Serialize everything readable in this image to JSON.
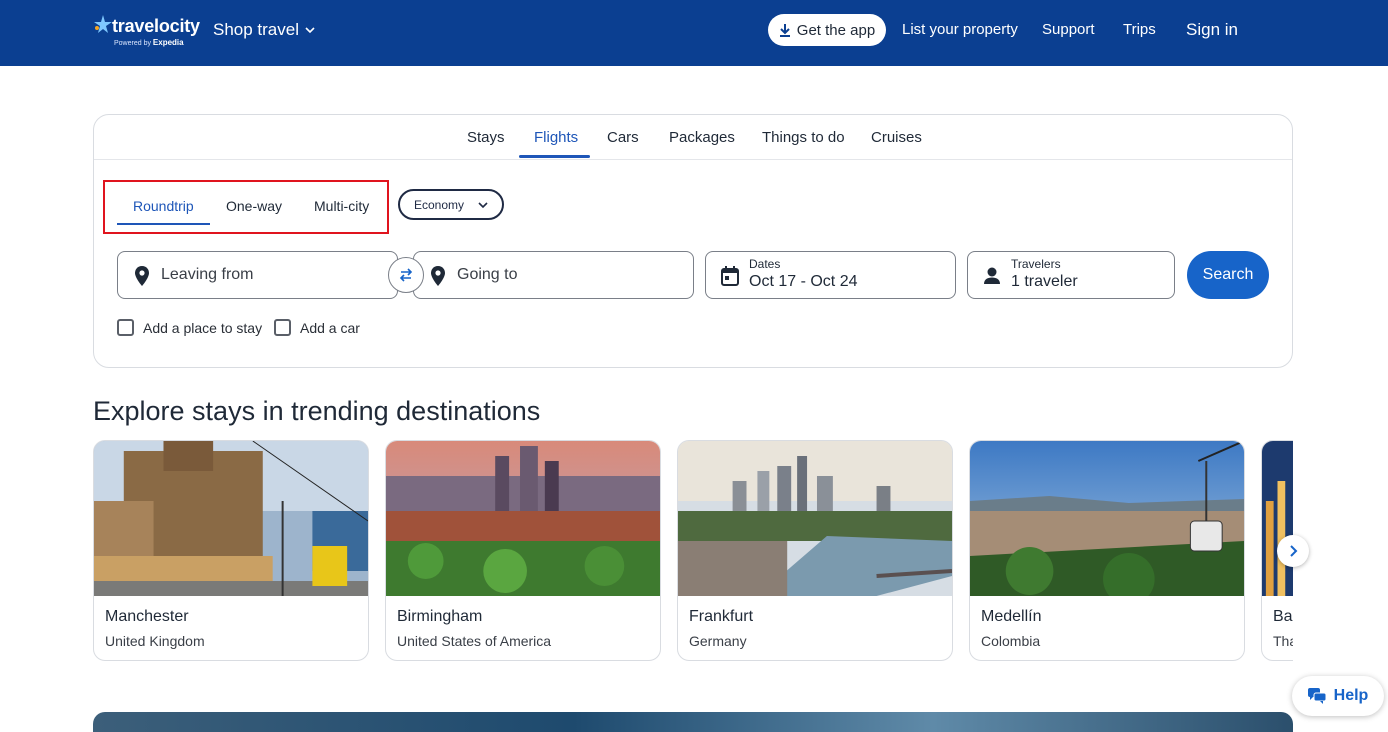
{
  "header": {
    "logo_text": "travelocity",
    "logo_powered": "Powered by",
    "logo_brand": "Expedia",
    "shop_label": "Shop travel",
    "get_app_label": "Get the app",
    "list_property_label": "List your property",
    "support_label": "Support",
    "trips_label": "Trips",
    "sign_in_label": "Sign in"
  },
  "search": {
    "tabs": [
      {
        "label": "Stays"
      },
      {
        "label": "Flights",
        "active": true
      },
      {
        "label": "Cars"
      },
      {
        "label": "Packages"
      },
      {
        "label": "Things to do"
      },
      {
        "label": "Cruises"
      }
    ],
    "trip_types": [
      {
        "label": "Roundtrip",
        "active": true
      },
      {
        "label": "One-way"
      },
      {
        "label": "Multi-city"
      }
    ],
    "cabin_class": "Economy",
    "leaving_placeholder": "Leaving from",
    "going_placeholder": "Going to",
    "dates_label": "Dates",
    "dates_value": "Oct 17 - Oct 24",
    "travelers_label": "Travelers",
    "travelers_value": "1 traveler",
    "search_button": "Search",
    "add_stay_label": "Add a place to stay",
    "add_car_label": "Add a car"
  },
  "explore": {
    "title": "Explore stays in trending destinations",
    "destinations": [
      {
        "city": "Manchester",
        "country": "United Kingdom"
      },
      {
        "city": "Birmingham",
        "country": "United States of America"
      },
      {
        "city": "Frankfurt",
        "country": "Germany"
      },
      {
        "city": "Medellín",
        "country": "Colombia"
      },
      {
        "city": "Ba",
        "country": "Tha"
      }
    ]
  },
  "help_label": "Help",
  "colors": {
    "header_bg": "#0b3f91",
    "accent": "#1764c9",
    "highlight_box": "#e0141e"
  }
}
